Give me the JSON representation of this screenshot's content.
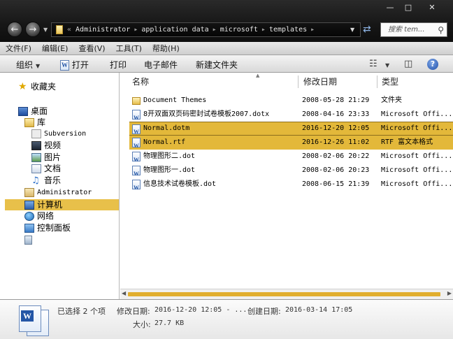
{
  "window": {
    "minimize": "—",
    "maximize": "□",
    "close": "✕"
  },
  "address": {
    "chevron": "«",
    "segments": [
      "Administrator",
      "application data",
      "microsoft",
      "templates"
    ],
    "separator": "▸"
  },
  "search": {
    "placeholder": "搜索 tem...",
    "icon": "search-icon"
  },
  "menu": [
    "文件(F)",
    "编辑(E)",
    "查看(V)",
    "工具(T)",
    "帮助(H)"
  ],
  "commands": {
    "organize": "组织",
    "open": "打开",
    "print": "打印",
    "email": "电子邮件",
    "new_folder": "新建文件夹",
    "help": "?"
  },
  "nav": {
    "favorites": "收藏夹",
    "desktop": "桌面",
    "libraries": "库",
    "subversion": "Subversion",
    "videos": "视频",
    "pictures": "图片",
    "documents": "文档",
    "music": "音乐",
    "administrator": "Administrator",
    "computer": "计算机",
    "network": "网络",
    "control_panel": "控制面板"
  },
  "columns": {
    "name": "名称",
    "date": "修改日期",
    "type": "类型"
  },
  "files": [
    {
      "name": "Document Themes",
      "date": "2008-05-28 21:29",
      "type": "文件夹",
      "icon": "folder-icon",
      "selected": false
    },
    {
      "name": "8开双面双页码密封试卷模板2007.dotx",
      "date": "2008-04-16 23:33",
      "type": "Microsoft Offi...",
      "icon": "word-doc-icon",
      "selected": false
    },
    {
      "name": "Normal.dotm",
      "date": "2016-12-20 12:05",
      "type": "Microsoft Offi...",
      "icon": "word-doc-icon",
      "selected": true
    },
    {
      "name": "Normal.rtf",
      "date": "2016-12-26 11:02",
      "type": "RTF 富文本格式",
      "icon": "word-doc-icon",
      "selected": true
    },
    {
      "name": "物理图形二.dot",
      "date": "2008-02-06 20:22",
      "type": "Microsoft Offi...",
      "icon": "word-doc-icon",
      "selected": false
    },
    {
      "name": "物理图形一.dot",
      "date": "2008-02-06 20:23",
      "type": "Microsoft Offi...",
      "icon": "word-doc-icon",
      "selected": false
    },
    {
      "name": "信息技术试卷模板.dot",
      "date": "2008-06-15 21:39",
      "type": "Microsoft Offi...",
      "icon": "word-doc-icon",
      "selected": false
    }
  ],
  "details": {
    "selection": "已选择 2 个项",
    "modified_label": "修改日期:",
    "modified_value": "2016-12-20 12:05 - ...",
    "created_label": "创建日期:",
    "created_value": "2016-03-14 17:05",
    "size_label": "大小:",
    "size_value": "27.7 KB"
  },
  "colors": {
    "selection": "#e3b83a",
    "nav_selection": "#e8c04a",
    "titlebar": "#161616"
  }
}
